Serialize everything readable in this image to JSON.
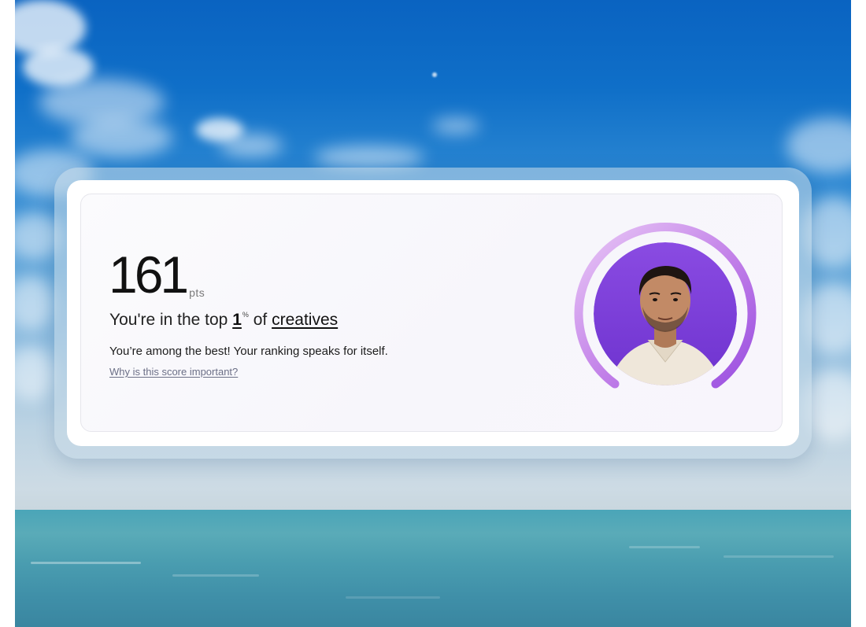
{
  "score": {
    "value": "161",
    "unit": "pts"
  },
  "ranking": {
    "prefix": "You're in the top",
    "percentile": "1",
    "percent_sign": "%",
    "connector": "of",
    "group": "creatives"
  },
  "message": "You’re among the best! Your ranking speaks for itself.",
  "help_link": "Why is this score important?",
  "avatar": {
    "ring_color_start": "#e2b8f2",
    "ring_color_end": "#9a4fe0",
    "background_color": "#7b3fd6"
  }
}
